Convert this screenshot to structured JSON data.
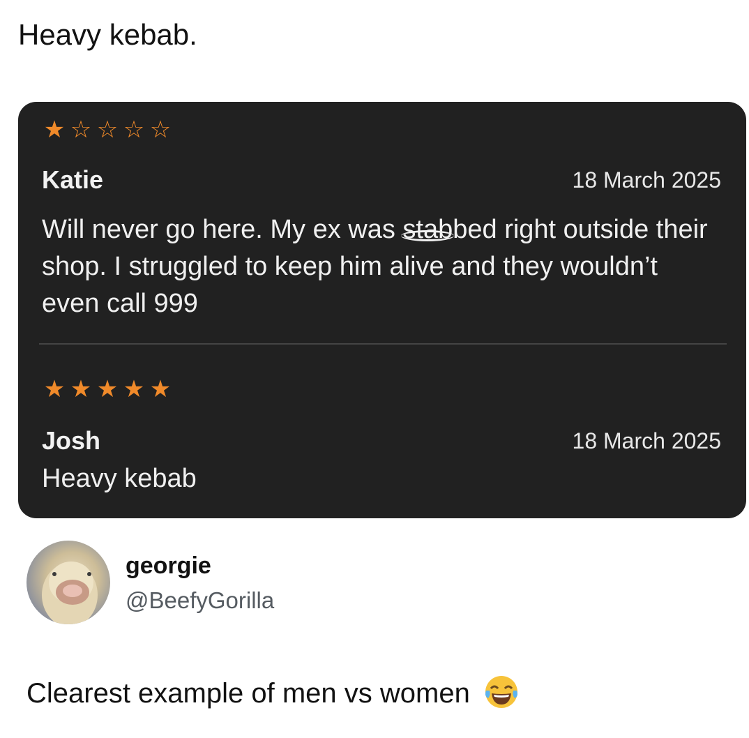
{
  "post": {
    "title": "Heavy kebab."
  },
  "reviews": [
    {
      "stars_filled": 1,
      "stars_total": 5,
      "reviewer": "Katie",
      "date": "18 March 2025",
      "text_before": "Will never go here. My ex was ",
      "text_struck": "stab",
      "text_after": "bed right outside their shop. I struggled to keep him alive and they wouldn’t even call 999"
    },
    {
      "stars_filled": 5,
      "stars_total": 5,
      "reviewer": "Josh",
      "date": "18 March 2025",
      "text": "Heavy kebab"
    }
  ],
  "author": {
    "name": "georgie",
    "handle": "@BeefyGorilla",
    "avatar_icon": "duck-avatar"
  },
  "comment": {
    "text": "Clearest example of men vs women",
    "emoji_icon": "face-with-tears-of-joy-emoji"
  },
  "colors": {
    "card_background": "#212121",
    "star": "#f08a2a",
    "handle": "#555b61"
  }
}
